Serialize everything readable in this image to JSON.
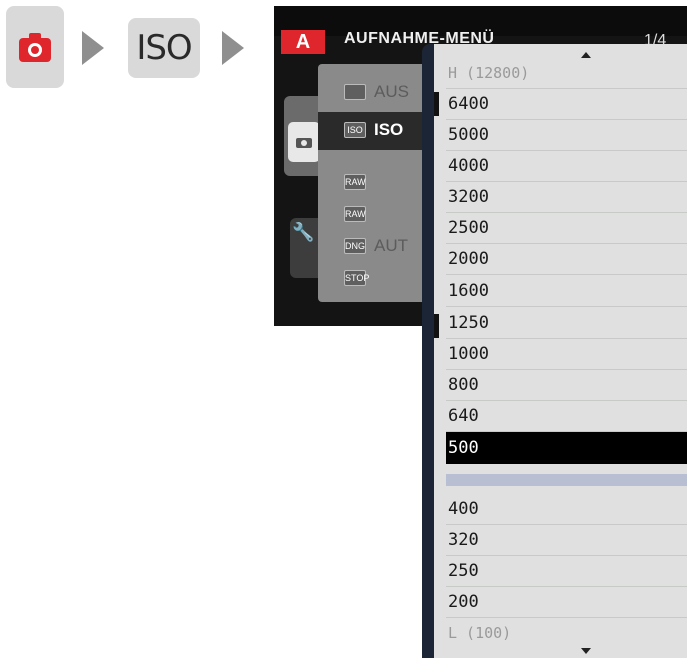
{
  "breadcrumb": {
    "camera_icon": "camera-icon",
    "accent": "#e0262d",
    "iso_label": "ISO"
  },
  "camera_screen": {
    "mode_badge": "A",
    "menu_title": "AUFNAHME-MENÜ",
    "page_indicator": "1/4",
    "menu_rows": [
      {
        "label": "AUS",
        "icon": "timer-icon"
      },
      {
        "label": "ISO",
        "icon": "iso-icon",
        "icon_text": "ISO",
        "selected": true
      },
      {
        "label": "",
        "icon": "raw-icon",
        "icon_text": "RAW"
      },
      {
        "label": "",
        "icon": "raw2-icon",
        "icon_text": "RAW"
      },
      {
        "label": "AUT",
        "icon": "dng-icon",
        "icon_text": "DNG"
      },
      {
        "label": "",
        "icon": "stop-icon",
        "icon_text": "STOP"
      }
    ]
  },
  "iso_list": {
    "items": [
      "H (12800)",
      "6400",
      "5000",
      "4000",
      "3200",
      "2500",
      "2000",
      "1600",
      "1250",
      "1000",
      "800",
      "640",
      "500",
      "400",
      "320",
      "250",
      "200",
      "L (100)"
    ],
    "selected": "500"
  }
}
